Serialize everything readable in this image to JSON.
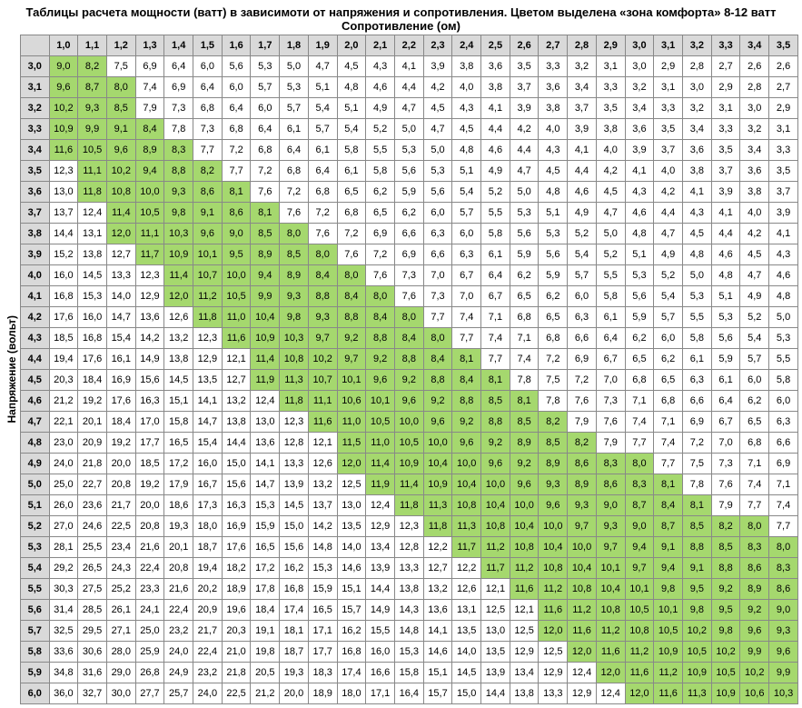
{
  "title": "Таблицы расчета мощности (ватт) в зависимоти от напряжения и сопротивления. Цветом выделена «зона комфорта» 8-12 ватт",
  "subtitle": "Сопротивление (ом)",
  "ylabel": "Напряжение (вольт)",
  "comfort_min": 8.0,
  "comfort_max": 12.0,
  "chart_data": {
    "type": "table",
    "title": "Таблицы расчета мощности (ватт) в зависимоти от напряжения и сопротивления. Цветом выделена «зона комфорта» 8-12 ватт",
    "xlabel": "Сопротивление (ом)",
    "ylabel": "Напряжение (вольт)",
    "col_headers": [
      "1,0",
      "1,1",
      "1,2",
      "1,3",
      "1,4",
      "1,5",
      "1,6",
      "1,7",
      "1,8",
      "1,9",
      "2,0",
      "2,1",
      "2,2",
      "2,3",
      "2,4",
      "2,5",
      "2,6",
      "2,7",
      "2,8",
      "2,9",
      "3,0",
      "3,1",
      "3,2",
      "3,3",
      "3,4",
      "3,5"
    ],
    "row_headers": [
      "3,0",
      "3,1",
      "3,2",
      "3,3",
      "3,4",
      "3,5",
      "3,6",
      "3,7",
      "3,8",
      "3,9",
      "4,0",
      "4,1",
      "4,2",
      "4,3",
      "4,4",
      "4,5",
      "4,6",
      "4,7",
      "4,8",
      "4,9",
      "5,0",
      "5,1",
      "5,2",
      "5,3",
      "5,4",
      "5,5",
      "5,6",
      "5,7",
      "5,8",
      "5,9",
      "6,0"
    ],
    "values": [
      [
        "9,0",
        "8,2",
        "7,5",
        "6,9",
        "6,4",
        "6,0",
        "5,6",
        "5,3",
        "5,0",
        "4,7",
        "4,5",
        "4,3",
        "4,1",
        "3,9",
        "3,8",
        "3,6",
        "3,5",
        "3,3",
        "3,2",
        "3,1",
        "3,0",
        "2,9",
        "2,8",
        "2,7",
        "2,6",
        "2,6"
      ],
      [
        "9,6",
        "8,7",
        "8,0",
        "7,4",
        "6,9",
        "6,4",
        "6,0",
        "5,7",
        "5,3",
        "5,1",
        "4,8",
        "4,6",
        "4,4",
        "4,2",
        "4,0",
        "3,8",
        "3,7",
        "3,6",
        "3,4",
        "3,3",
        "3,2",
        "3,1",
        "3,0",
        "2,9",
        "2,8",
        "2,7"
      ],
      [
        "10,2",
        "9,3",
        "8,5",
        "7,9",
        "7,3",
        "6,8",
        "6,4",
        "6,0",
        "5,7",
        "5,4",
        "5,1",
        "4,9",
        "4,7",
        "4,5",
        "4,3",
        "4,1",
        "3,9",
        "3,8",
        "3,7",
        "3,5",
        "3,4",
        "3,3",
        "3,2",
        "3,1",
        "3,0",
        "2,9"
      ],
      [
        "10,9",
        "9,9",
        "9,1",
        "8,4",
        "7,8",
        "7,3",
        "6,8",
        "6,4",
        "6,1",
        "5,7",
        "5,4",
        "5,2",
        "5,0",
        "4,7",
        "4,5",
        "4,4",
        "4,2",
        "4,0",
        "3,9",
        "3,8",
        "3,6",
        "3,5",
        "3,4",
        "3,3",
        "3,2",
        "3,1"
      ],
      [
        "11,6",
        "10,5",
        "9,6",
        "8,9",
        "8,3",
        "7,7",
        "7,2",
        "6,8",
        "6,4",
        "6,1",
        "5,8",
        "5,5",
        "5,3",
        "5,0",
        "4,8",
        "4,6",
        "4,4",
        "4,3",
        "4,1",
        "4,0",
        "3,9",
        "3,7",
        "3,6",
        "3,5",
        "3,4",
        "3,3"
      ],
      [
        "12,3",
        "11,1",
        "10,2",
        "9,4",
        "8,8",
        "8,2",
        "7,7",
        "7,2",
        "6,8",
        "6,4",
        "6,1",
        "5,8",
        "5,6",
        "5,3",
        "5,1",
        "4,9",
        "4,7",
        "4,5",
        "4,4",
        "4,2",
        "4,1",
        "4,0",
        "3,8",
        "3,7",
        "3,6",
        "3,5"
      ],
      [
        "13,0",
        "11,8",
        "10,8",
        "10,0",
        "9,3",
        "8,6",
        "8,1",
        "7,6",
        "7,2",
        "6,8",
        "6,5",
        "6,2",
        "5,9",
        "5,6",
        "5,4",
        "5,2",
        "5,0",
        "4,8",
        "4,6",
        "4,5",
        "4,3",
        "4,2",
        "4,1",
        "3,9",
        "3,8",
        "3,7"
      ],
      [
        "13,7",
        "12,4",
        "11,4",
        "10,5",
        "9,8",
        "9,1",
        "8,6",
        "8,1",
        "7,6",
        "7,2",
        "6,8",
        "6,5",
        "6,2",
        "6,0",
        "5,7",
        "5,5",
        "5,3",
        "5,1",
        "4,9",
        "4,7",
        "4,6",
        "4,4",
        "4,3",
        "4,1",
        "4,0",
        "3,9"
      ],
      [
        "14,4",
        "13,1",
        "12,0",
        "11,1",
        "10,3",
        "9,6",
        "9,0",
        "8,5",
        "8,0",
        "7,6",
        "7,2",
        "6,9",
        "6,6",
        "6,3",
        "6,0",
        "5,8",
        "5,6",
        "5,3",
        "5,2",
        "5,0",
        "4,8",
        "4,7",
        "4,5",
        "4,4",
        "4,2",
        "4,1"
      ],
      [
        "15,2",
        "13,8",
        "12,7",
        "11,7",
        "10,9",
        "10,1",
        "9,5",
        "8,9",
        "8,5",
        "8,0",
        "7,6",
        "7,2",
        "6,9",
        "6,6",
        "6,3",
        "6,1",
        "5,9",
        "5,6",
        "5,4",
        "5,2",
        "5,1",
        "4,9",
        "4,8",
        "4,6",
        "4,5",
        "4,3"
      ],
      [
        "16,0",
        "14,5",
        "13,3",
        "12,3",
        "11,4",
        "10,7",
        "10,0",
        "9,4",
        "8,9",
        "8,4",
        "8,0",
        "7,6",
        "7,3",
        "7,0",
        "6,7",
        "6,4",
        "6,2",
        "5,9",
        "5,7",
        "5,5",
        "5,3",
        "5,2",
        "5,0",
        "4,8",
        "4,7",
        "4,6"
      ],
      [
        "16,8",
        "15,3",
        "14,0",
        "12,9",
        "12,0",
        "11,2",
        "10,5",
        "9,9",
        "9,3",
        "8,8",
        "8,4",
        "8,0",
        "7,6",
        "7,3",
        "7,0",
        "6,7",
        "6,5",
        "6,2",
        "6,0",
        "5,8",
        "5,6",
        "5,4",
        "5,3",
        "5,1",
        "4,9",
        "4,8"
      ],
      [
        "17,6",
        "16,0",
        "14,7",
        "13,6",
        "12,6",
        "11,8",
        "11,0",
        "10,4",
        "9,8",
        "9,3",
        "8,8",
        "8,4",
        "8,0",
        "7,7",
        "7,4",
        "7,1",
        "6,8",
        "6,5",
        "6,3",
        "6,1",
        "5,9",
        "5,7",
        "5,5",
        "5,3",
        "5,2",
        "5,0"
      ],
      [
        "18,5",
        "16,8",
        "15,4",
        "14,2",
        "13,2",
        "12,3",
        "11,6",
        "10,9",
        "10,3",
        "9,7",
        "9,2",
        "8,8",
        "8,4",
        "8,0",
        "7,7",
        "7,4",
        "7,1",
        "6,8",
        "6,6",
        "6,4",
        "6,2",
        "6,0",
        "5,8",
        "5,6",
        "5,4",
        "5,3"
      ],
      [
        "19,4",
        "17,6",
        "16,1",
        "14,9",
        "13,8",
        "12,9",
        "12,1",
        "11,4",
        "10,8",
        "10,2",
        "9,7",
        "9,2",
        "8,8",
        "8,4",
        "8,1",
        "7,7",
        "7,4",
        "7,2",
        "6,9",
        "6,7",
        "6,5",
        "6,2",
        "6,1",
        "5,9",
        "5,7",
        "5,5"
      ],
      [
        "20,3",
        "18,4",
        "16,9",
        "15,6",
        "14,5",
        "13,5",
        "12,7",
        "11,9",
        "11,3",
        "10,7",
        "10,1",
        "9,6",
        "9,2",
        "8,8",
        "8,4",
        "8,1",
        "7,8",
        "7,5",
        "7,2",
        "7,0",
        "6,8",
        "6,5",
        "6,3",
        "6,1",
        "6,0",
        "5,8"
      ],
      [
        "21,2",
        "19,2",
        "17,6",
        "16,3",
        "15,1",
        "14,1",
        "13,2",
        "12,4",
        "11,8",
        "11,1",
        "10,6",
        "10,1",
        "9,6",
        "9,2",
        "8,8",
        "8,5",
        "8,1",
        "7,8",
        "7,6",
        "7,3",
        "7,1",
        "6,8",
        "6,6",
        "6,4",
        "6,2",
        "6,0"
      ],
      [
        "22,1",
        "20,1",
        "18,4",
        "17,0",
        "15,8",
        "14,7",
        "13,8",
        "13,0",
        "12,3",
        "11,6",
        "11,0",
        "10,5",
        "10,0",
        "9,6",
        "9,2",
        "8,8",
        "8,5",
        "8,2",
        "7,9",
        "7,6",
        "7,4",
        "7,1",
        "6,9",
        "6,7",
        "6,5",
        "6,3"
      ],
      [
        "23,0",
        "20,9",
        "19,2",
        "17,7",
        "16,5",
        "15,4",
        "14,4",
        "13,6",
        "12,8",
        "12,1",
        "11,5",
        "11,0",
        "10,5",
        "10,0",
        "9,6",
        "9,2",
        "8,9",
        "8,5",
        "8,2",
        "7,9",
        "7,7",
        "7,4",
        "7,2",
        "7,0",
        "6,8",
        "6,6"
      ],
      [
        "24,0",
        "21,8",
        "20,0",
        "18,5",
        "17,2",
        "16,0",
        "15,0",
        "14,1",
        "13,3",
        "12,6",
        "12,0",
        "11,4",
        "10,9",
        "10,4",
        "10,0",
        "9,6",
        "9,2",
        "8,9",
        "8,6",
        "8,3",
        "8,0",
        "7,7",
        "7,5",
        "7,3",
        "7,1",
        "6,9"
      ],
      [
        "25,0",
        "22,7",
        "20,8",
        "19,2",
        "17,9",
        "16,7",
        "15,6",
        "14,7",
        "13,9",
        "13,2",
        "12,5",
        "11,9",
        "11,4",
        "10,9",
        "10,4",
        "10,0",
        "9,6",
        "9,3",
        "8,9",
        "8,6",
        "8,3",
        "8,1",
        "7,8",
        "7,6",
        "7,4",
        "7,1"
      ],
      [
        "26,0",
        "23,6",
        "21,7",
        "20,0",
        "18,6",
        "17,3",
        "16,3",
        "15,3",
        "14,5",
        "13,7",
        "13,0",
        "12,4",
        "11,8",
        "11,3",
        "10,8",
        "10,4",
        "10,0",
        "9,6",
        "9,3",
        "9,0",
        "8,7",
        "8,4",
        "8,1",
        "7,9",
        "7,7",
        "7,4"
      ],
      [
        "27,0",
        "24,6",
        "22,5",
        "20,8",
        "19,3",
        "18,0",
        "16,9",
        "15,9",
        "15,0",
        "14,2",
        "13,5",
        "12,9",
        "12,3",
        "11,8",
        "11,3",
        "10,8",
        "10,4",
        "10,0",
        "9,7",
        "9,3",
        "9,0",
        "8,7",
        "8,5",
        "8,2",
        "8,0",
        "7,7"
      ],
      [
        "28,1",
        "25,5",
        "23,4",
        "21,6",
        "20,1",
        "18,7",
        "17,6",
        "16,5",
        "15,6",
        "14,8",
        "14,0",
        "13,4",
        "12,8",
        "12,2",
        "11,7",
        "11,2",
        "10,8",
        "10,4",
        "10,0",
        "9,7",
        "9,4",
        "9,1",
        "8,8",
        "8,5",
        "8,3",
        "8,0"
      ],
      [
        "29,2",
        "26,5",
        "24,3",
        "22,4",
        "20,8",
        "19,4",
        "18,2",
        "17,2",
        "16,2",
        "15,3",
        "14,6",
        "13,9",
        "13,3",
        "12,7",
        "12,2",
        "11,7",
        "11,2",
        "10,8",
        "10,4",
        "10,1",
        "9,7",
        "9,4",
        "9,1",
        "8,8",
        "8,6",
        "8,3"
      ],
      [
        "30,3",
        "27,5",
        "25,2",
        "23,3",
        "21,6",
        "20,2",
        "18,9",
        "17,8",
        "16,8",
        "15,9",
        "15,1",
        "14,4",
        "13,8",
        "13,2",
        "12,6",
        "12,1",
        "11,6",
        "11,2",
        "10,8",
        "10,4",
        "10,1",
        "9,8",
        "9,5",
        "9,2",
        "8,9",
        "8,6"
      ],
      [
        "31,4",
        "28,5",
        "26,1",
        "24,1",
        "22,4",
        "20,9",
        "19,6",
        "18,4",
        "17,4",
        "16,5",
        "15,7",
        "14,9",
        "14,3",
        "13,6",
        "13,1",
        "12,5",
        "12,1",
        "11,6",
        "11,2",
        "10,8",
        "10,5",
        "10,1",
        "9,8",
        "9,5",
        "9,2",
        "9,0"
      ],
      [
        "32,5",
        "29,5",
        "27,1",
        "25,0",
        "23,2",
        "21,7",
        "20,3",
        "19,1",
        "18,1",
        "17,1",
        "16,2",
        "15,5",
        "14,8",
        "14,1",
        "13,5",
        "13,0",
        "12,5",
        "12,0",
        "11,6",
        "11,2",
        "10,8",
        "10,5",
        "10,2",
        "9,8",
        "9,6",
        "9,3"
      ],
      [
        "33,6",
        "30,6",
        "28,0",
        "25,9",
        "24,0",
        "22,4",
        "21,0",
        "19,8",
        "18,7",
        "17,7",
        "16,8",
        "16,0",
        "15,3",
        "14,6",
        "14,0",
        "13,5",
        "12,9",
        "12,5",
        "12,0",
        "11,6",
        "11,2",
        "10,9",
        "10,5",
        "10,2",
        "9,9",
        "9,6"
      ],
      [
        "34,8",
        "31,6",
        "29,0",
        "26,8",
        "24,9",
        "23,2",
        "21,8",
        "20,5",
        "19,3",
        "18,3",
        "17,4",
        "16,6",
        "15,8",
        "15,1",
        "14,5",
        "13,9",
        "13,4",
        "12,9",
        "12,4",
        "12,0",
        "11,6",
        "11,2",
        "10,9",
        "10,5",
        "10,2",
        "9,9"
      ],
      [
        "36,0",
        "32,7",
        "30,0",
        "27,7",
        "25,7",
        "24,0",
        "22,5",
        "21,2",
        "20,0",
        "18,9",
        "18,0",
        "17,1",
        "16,4",
        "15,7",
        "15,0",
        "14,4",
        "13,8",
        "13,3",
        "12,9",
        "12,4",
        "12,0",
        "11,6",
        "11,3",
        "10,9",
        "10,6",
        "10,3"
      ]
    ]
  }
}
